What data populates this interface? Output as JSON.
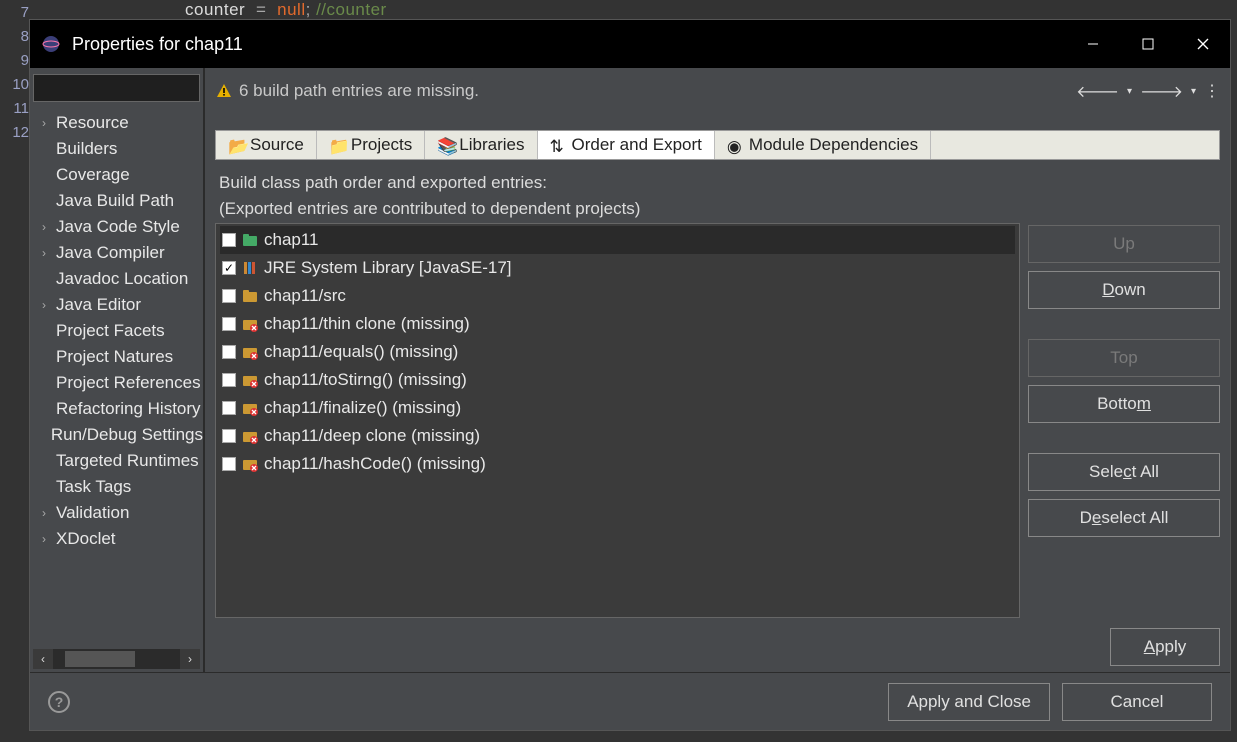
{
  "gutter_lines": [
    "7",
    "8",
    "9",
    "10",
    "11",
    "12"
  ],
  "editor_code_html": "counter = null; //counter",
  "titlebar": {
    "title": "Properties for chap11"
  },
  "header": {
    "warning_text": "6 build path entries are missing."
  },
  "tree": {
    "items": [
      {
        "label": "Resource",
        "expandable": true
      },
      {
        "label": "Builders",
        "expandable": false
      },
      {
        "label": "Coverage",
        "expandable": false
      },
      {
        "label": "Java Build Path",
        "expandable": false
      },
      {
        "label": "Java Code Style",
        "expandable": true
      },
      {
        "label": "Java Compiler",
        "expandable": true
      },
      {
        "label": "Javadoc Location",
        "expandable": false
      },
      {
        "label": "Java Editor",
        "expandable": true
      },
      {
        "label": "Project Facets",
        "expandable": false
      },
      {
        "label": "Project Natures",
        "expandable": false
      },
      {
        "label": "Project References",
        "expandable": false
      },
      {
        "label": "Refactoring History",
        "expandable": false
      },
      {
        "label": "Run/Debug Settings",
        "expandable": false
      },
      {
        "label": "Targeted Runtimes",
        "expandable": false
      },
      {
        "label": "Task Tags",
        "expandable": false
      },
      {
        "label": "Validation",
        "expandable": true
      },
      {
        "label": "XDoclet",
        "expandable": true
      }
    ]
  },
  "tabs": [
    {
      "label": "Source",
      "icon": "📂"
    },
    {
      "label": "Projects",
      "icon": "📁"
    },
    {
      "label": "Libraries",
      "icon": "📚"
    },
    {
      "label": "Order and Export",
      "icon": "⇅",
      "active": true
    },
    {
      "label": "Module Dependencies",
      "icon": "◉"
    }
  ],
  "instructions": {
    "line1": "Build class path order and exported entries:",
    "line2": "(Exported entries are contributed to dependent projects)"
  },
  "entries": [
    {
      "label": "chap11",
      "checked": false,
      "icon": "project",
      "selected": true
    },
    {
      "label": "JRE System Library [JavaSE-17]",
      "checked": true,
      "icon": "library"
    },
    {
      "label": "chap11/src",
      "checked": false,
      "icon": "srcfolder"
    },
    {
      "label": "chap11/thin clone (missing)",
      "checked": false,
      "icon": "missing"
    },
    {
      "label": "chap11/equals() (missing)",
      "checked": false,
      "icon": "missing"
    },
    {
      "label": "chap11/toStirng() (missing)",
      "checked": false,
      "icon": "missing"
    },
    {
      "label": "chap11/finalize() (missing)",
      "checked": false,
      "icon": "missing"
    },
    {
      "label": "chap11/deep clone (missing)",
      "checked": false,
      "icon": "missing"
    },
    {
      "label": "chap11/hashCode() (missing)",
      "checked": false,
      "icon": "missing"
    }
  ],
  "side_buttons": {
    "up": "Up",
    "down": "Down",
    "top": "Top",
    "bottom": "Bottom",
    "select_all": "Select All",
    "deselect_all": "Deselect All"
  },
  "apply_button": "Apply",
  "footer": {
    "apply_close": "Apply and Close",
    "cancel": "Cancel"
  },
  "colors": {
    "dialog_bg": "#47494c",
    "list_bg": "#3b3b3b",
    "titlebar": "#000000"
  }
}
